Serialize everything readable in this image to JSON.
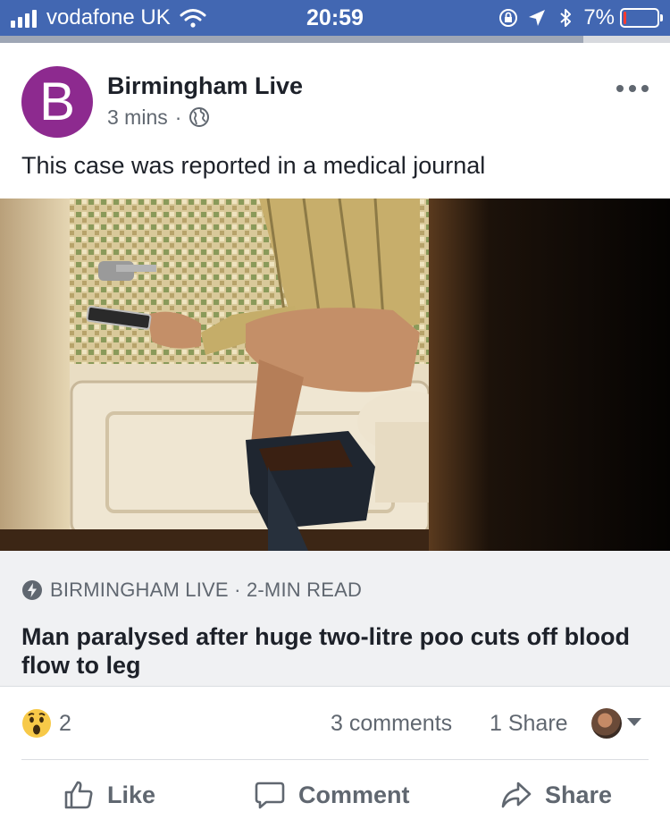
{
  "status_bar": {
    "carrier": "vodafone UK",
    "time": "20:59",
    "battery": "7%",
    "battery_level": 0.07,
    "load_progress": 0.87
  },
  "post": {
    "page_name": "Birmingham Live",
    "avatar_letter": "B",
    "avatar_color": "#8d2a8f",
    "time_ago": "3 mins",
    "separator": "·",
    "privacy_icon": "globe-icon",
    "text": "This case was reported in a medical journal"
  },
  "link": {
    "source": "BIRMINGHAM LIVE · 2-MIN READ",
    "source_icon": "bolt-icon",
    "title": "Man paralysed after huge two-litre poo cuts off blood flow to leg"
  },
  "reactions": {
    "icon": "wow-icon",
    "count": "2",
    "comments": "3 comments",
    "shares": "1 Share"
  },
  "actions": {
    "like": "Like",
    "comment": "Comment",
    "share": "Share"
  },
  "colors": {
    "status_bar": "#4267b2",
    "text_primary": "#1d2129",
    "text_secondary": "#606770",
    "link_bg": "#f0f1f3"
  }
}
